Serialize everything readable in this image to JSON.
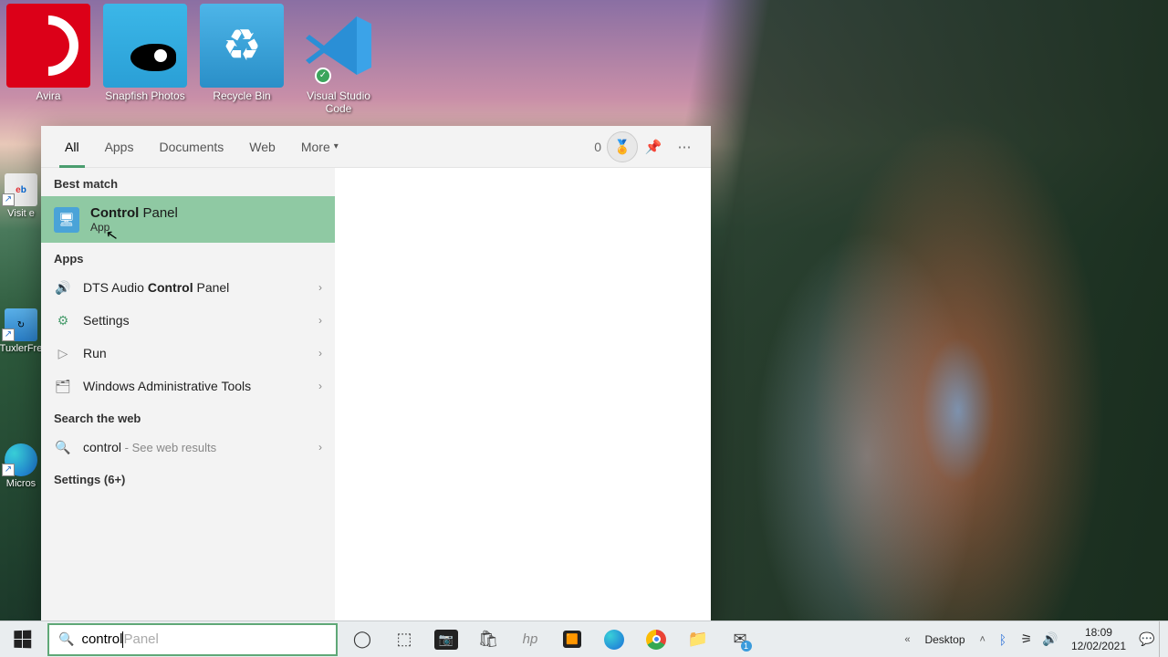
{
  "desktop_icons": [
    {
      "id": "avira",
      "label": "Avira"
    },
    {
      "id": "snapfish",
      "label": "Snapfish Photos"
    },
    {
      "id": "recycle",
      "label": "Recycle Bin"
    },
    {
      "id": "vscode",
      "label": "Visual Studio Code"
    }
  ],
  "left_icons": {
    "ebay": "Visit e",
    "tuxler": "TuxlerFre",
    "edge": "Micros"
  },
  "search": {
    "tabs": {
      "all": "All",
      "apps": "Apps",
      "documents": "Documents",
      "web": "Web",
      "more": "More"
    },
    "rewards_count": "0",
    "sections": {
      "best_match": "Best match",
      "apps": "Apps",
      "search_web": "Search the web",
      "settings_more": "Settings (6+)"
    },
    "best_match": {
      "title_bold": "Control",
      "title_rest": " Panel",
      "subtitle": "App"
    },
    "app_results": [
      {
        "pre": "DTS Audio ",
        "bold": "Control",
        "post": " Panel",
        "icon": "🔊",
        "color": "#e8a23c"
      },
      {
        "pre": "",
        "bold": "",
        "post": "Settings",
        "icon": "⚙",
        "color": "#4a9d6e"
      },
      {
        "pre": "",
        "bold": "",
        "post": "Run",
        "icon": "▷",
        "color": "#888"
      },
      {
        "pre": "",
        "bold": "",
        "post": "Windows Administrative Tools",
        "icon": "🗂",
        "color": "#666"
      }
    ],
    "web_result": {
      "term": "control",
      "suffix": " - See web results"
    },
    "input_typed": "control",
    "input_ghost": " Panel"
  },
  "taskbar": {
    "systray": {
      "desktop_label": "Desktop",
      "time": "18:09",
      "date": "12/02/2021"
    }
  }
}
